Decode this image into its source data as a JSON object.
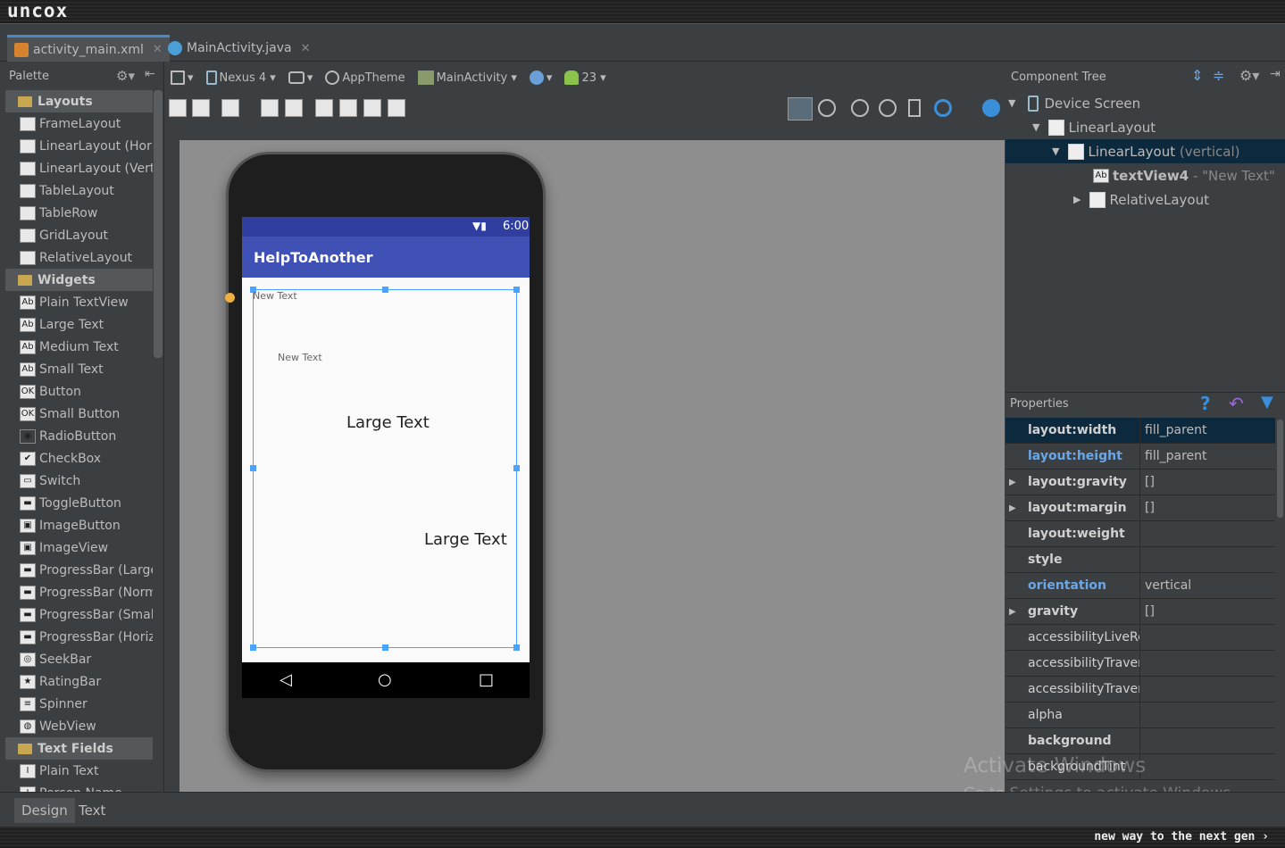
{
  "brand": "uncox",
  "tagline": "new way to the next gen ›",
  "file_tabs": [
    {
      "label": "activity_main.xml"
    },
    {
      "label": "MainActivity.java"
    }
  ],
  "palette": {
    "title": "Palette",
    "groups": {
      "layouts": "Layouts",
      "widgets": "Widgets",
      "text_fields": "Text Fields"
    },
    "layouts": [
      "FrameLayout",
      "LinearLayout (Hori:",
      "LinearLayout (Verti",
      "TableLayout",
      "TableRow",
      "GridLayout",
      "RelativeLayout"
    ],
    "widgets": [
      "Plain TextView",
      "Large Text",
      "Medium Text",
      "Small Text",
      "Button",
      "Small Button",
      "RadioButton",
      "CheckBox",
      "Switch",
      "ToggleButton",
      "ImageButton",
      "ImageView",
      "ProgressBar (Large",
      "ProgressBar (Norm",
      "ProgressBar (Small",
      "ProgressBar (Horiz",
      "SeekBar",
      "RatingBar",
      "Spinner",
      "WebView"
    ],
    "text_fields": [
      "Plain Text",
      "Person Name"
    ]
  },
  "toolbar": {
    "device": "Nexus 4",
    "theme": "AppTheme",
    "activity": "MainActivity",
    "api": "23"
  },
  "device_screen": {
    "time": "6:00",
    "app_title": "HelpToAnother",
    "texts": {
      "small1": "New Text",
      "small2": "New Text",
      "large1": "Large Text",
      "large2": "Large Text"
    }
  },
  "component_tree": {
    "title": "Component Tree",
    "items": [
      {
        "label": "Device Screen"
      },
      {
        "label": "LinearLayout"
      },
      {
        "label": "LinearLayout",
        "suffix": "(vertical)"
      },
      {
        "label": "textView4",
        "suffix": "- \"New Text\""
      },
      {
        "label": "RelativeLayout"
      }
    ]
  },
  "properties": {
    "title": "Properties",
    "rows": [
      {
        "key": "layout:width",
        "value": "fill_parent"
      },
      {
        "key": "layout:height",
        "value": "fill_parent"
      },
      {
        "key": "layout:gravity",
        "value": "[]"
      },
      {
        "key": "layout:margin",
        "value": "[]"
      },
      {
        "key": "layout:weight",
        "value": ""
      },
      {
        "key": "style",
        "value": ""
      },
      {
        "key": "orientation",
        "value": "vertical"
      },
      {
        "key": "gravity",
        "value": "[]"
      },
      {
        "key": "accessibilityLiveReg",
        "value": ""
      },
      {
        "key": "accessibilityTravers",
        "value": ""
      },
      {
        "key": "accessibilityTravers",
        "value": ""
      },
      {
        "key": "alpha",
        "value": ""
      },
      {
        "key": "background",
        "value": ""
      },
      {
        "key": "backgroundTint",
        "value": ""
      }
    ]
  },
  "bottom_tabs": {
    "design": "Design",
    "text": "Text"
  },
  "watermark": {
    "line1": "Activate Windows",
    "line2": "Go to Settings to activate Windows."
  }
}
